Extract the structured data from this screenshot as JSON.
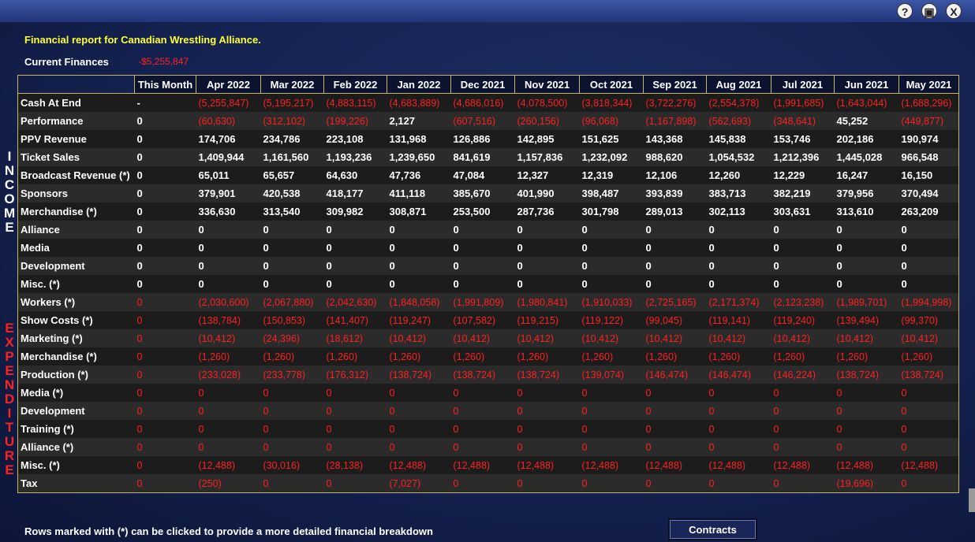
{
  "title": "Financial report for Canadian Wrestling Alliance.",
  "current_finances": {
    "label": "Current Finances",
    "value": "-$5,255,847"
  },
  "vertical_labels": {
    "income": [
      "I",
      "N",
      "C",
      "O",
      "M",
      "E"
    ],
    "expenditure": [
      "E",
      "X",
      "P",
      "E",
      "N",
      "D",
      "I",
      "T",
      "U",
      "R",
      "E"
    ]
  },
  "columns": [
    "This Month",
    "Apr 2022",
    "Mar 2022",
    "Feb 2022",
    "Jan 2022",
    "Dec 2021",
    "Nov 2021",
    "Oct 2021",
    "Sep 2021",
    "Aug 2021",
    "Jul 2021",
    "Jun 2021",
    "May 2021"
  ],
  "rows": [
    {
      "label": "Cash At End",
      "values": [
        "-",
        "(5,255,847)",
        "(5,195,217)",
        "(4,883,115)",
        "(4,683,889)",
        "(4,686,016)",
        "(4,078,500)",
        "(3,818,344)",
        "(3,722,276)",
        "(2,554,378)",
        "(1,991,685)",
        "(1,643,044)",
        "(1,688,296)"
      ]
    },
    {
      "label": "Performance",
      "values": [
        "0",
        "(60,630)",
        "(312,102)",
        "(199,226)",
        "2,127",
        "(607,516)",
        "(260,156)",
        "(96,068)",
        "(1,167,898)",
        "(562,693)",
        "(348,641)",
        "45,252",
        "(449,877)"
      ]
    },
    {
      "label": "PPV Revenue",
      "values": [
        "0",
        "174,706",
        "234,786",
        "223,108",
        "131,968",
        "126,886",
        "142,895",
        "151,625",
        "143,368",
        "145,838",
        "153,746",
        "202,186",
        "190,974"
      ]
    },
    {
      "label": "Ticket Sales",
      "values": [
        "0",
        "1,409,944",
        "1,161,560",
        "1,193,236",
        "1,239,650",
        "841,619",
        "1,157,836",
        "1,232,092",
        "988,620",
        "1,054,532",
        "1,212,396",
        "1,445,028",
        "966,548"
      ]
    },
    {
      "label": "Broadcast Revenue (*)",
      "values": [
        "0",
        "65,011",
        "65,657",
        "64,630",
        "47,736",
        "47,084",
        "12,327",
        "12,319",
        "12,106",
        "12,260",
        "12,229",
        "16,247",
        "16,150"
      ]
    },
    {
      "label": "Sponsors",
      "values": [
        "0",
        "379,901",
        "420,538",
        "418,177",
        "411,118",
        "385,670",
        "401,990",
        "398,487",
        "393,839",
        "383,713",
        "382,219",
        "379,956",
        "370,494"
      ]
    },
    {
      "label": "Merchandise (*)",
      "values": [
        "0",
        "336,630",
        "313,540",
        "309,982",
        "308,871",
        "253,500",
        "287,736",
        "301,798",
        "289,013",
        "302,113",
        "303,631",
        "313,610",
        "263,209"
      ]
    },
    {
      "label": "Alliance",
      "values": [
        "0",
        "0",
        "0",
        "0",
        "0",
        "0",
        "0",
        "0",
        "0",
        "0",
        "0",
        "0",
        "0"
      ]
    },
    {
      "label": "Media",
      "values": [
        "0",
        "0",
        "0",
        "0",
        "0",
        "0",
        "0",
        "0",
        "0",
        "0",
        "0",
        "0",
        "0"
      ]
    },
    {
      "label": "Development",
      "values": [
        "0",
        "0",
        "0",
        "0",
        "0",
        "0",
        "0",
        "0",
        "0",
        "0",
        "0",
        "0",
        "0"
      ]
    },
    {
      "label": "Misc. (*)",
      "values": [
        "0",
        "0",
        "0",
        "0",
        "0",
        "0",
        "0",
        "0",
        "0",
        "0",
        "0",
        "0",
        "0"
      ]
    },
    {
      "label": "Workers (*)",
      "values": [
        "0",
        "(2,030,600)",
        "(2,067,880)",
        "(2,042,630)",
        "(1,848,058)",
        "(1,991,809)",
        "(1,980,841)",
        "(1,910,033)",
        "(2,725,165)",
        "(2,171,374)",
        "(2,123,238)",
        "(1,989,701)",
        "(1,994,998)"
      ]
    },
    {
      "label": "Show Costs (*)",
      "values": [
        "0",
        "(138,784)",
        "(150,853)",
        "(141,407)",
        "(119,247)",
        "(107,582)",
        "(119,215)",
        "(119,122)",
        "(99,045)",
        "(119,141)",
        "(119,240)",
        "(139,494)",
        "(99,370)"
      ]
    },
    {
      "label": "Marketing (*)",
      "values": [
        "0",
        "(10,412)",
        "(24,396)",
        "(18,612)",
        "(10,412)",
        "(10,412)",
        "(10,412)",
        "(10,412)",
        "(10,412)",
        "(10,412)",
        "(10,412)",
        "(10,412)",
        "(10,412)"
      ]
    },
    {
      "label": "Merchandise (*)",
      "values": [
        "0",
        "(1,260)",
        "(1,260)",
        "(1,260)",
        "(1,260)",
        "(1,260)",
        "(1,260)",
        "(1,260)",
        "(1,260)",
        "(1,260)",
        "(1,260)",
        "(1,260)",
        "(1,260)"
      ]
    },
    {
      "label": "Production (*)",
      "values": [
        "0",
        "(233,028)",
        "(233,778)",
        "(176,312)",
        "(138,724)",
        "(138,724)",
        "(138,724)",
        "(139,074)",
        "(146,474)",
        "(146,474)",
        "(146,224)",
        "(138,724)",
        "(138,724)"
      ]
    },
    {
      "label": "Media (*)",
      "values": [
        "0",
        "0",
        "0",
        "0",
        "0",
        "0",
        "0",
        "0",
        "0",
        "0",
        "0",
        "0",
        "0"
      ]
    },
    {
      "label": "Development",
      "values": [
        "0",
        "0",
        "0",
        "0",
        "0",
        "0",
        "0",
        "0",
        "0",
        "0",
        "0",
        "0",
        "0"
      ]
    },
    {
      "label": "Training (*)",
      "values": [
        "0",
        "0",
        "0",
        "0",
        "0",
        "0",
        "0",
        "0",
        "0",
        "0",
        "0",
        "0",
        "0"
      ]
    },
    {
      "label": "Alliance (*)",
      "values": [
        "0",
        "0",
        "0",
        "0",
        "0",
        "0",
        "0",
        "0",
        "0",
        "0",
        "0",
        "0",
        "0"
      ]
    },
    {
      "label": "Misc. (*)",
      "values": [
        "0",
        "(12,488)",
        "(30,016)",
        "(28,138)",
        "(12,488)",
        "(12,488)",
        "(12,488)",
        "(12,488)",
        "(12,488)",
        "(12,488)",
        "(12,488)",
        "(12,488)",
        "(12,488)"
      ]
    },
    {
      "label": "Tax",
      "values": [
        "0",
        "(250)",
        "0",
        "0",
        "(7,027)",
        "0",
        "0",
        "0",
        "0",
        "0",
        "0",
        "(19,696)",
        "0"
      ]
    }
  ],
  "footer_note": "Rows marked with (*) can be clicked to provide a more detailed financial breakdown",
  "contracts_button": "Contracts",
  "window_buttons": {
    "help": "?",
    "minimize": "▣",
    "close": "X"
  },
  "colors": {
    "negative": "#ff2020",
    "title": "#ffff33",
    "border": "#c8b560"
  }
}
